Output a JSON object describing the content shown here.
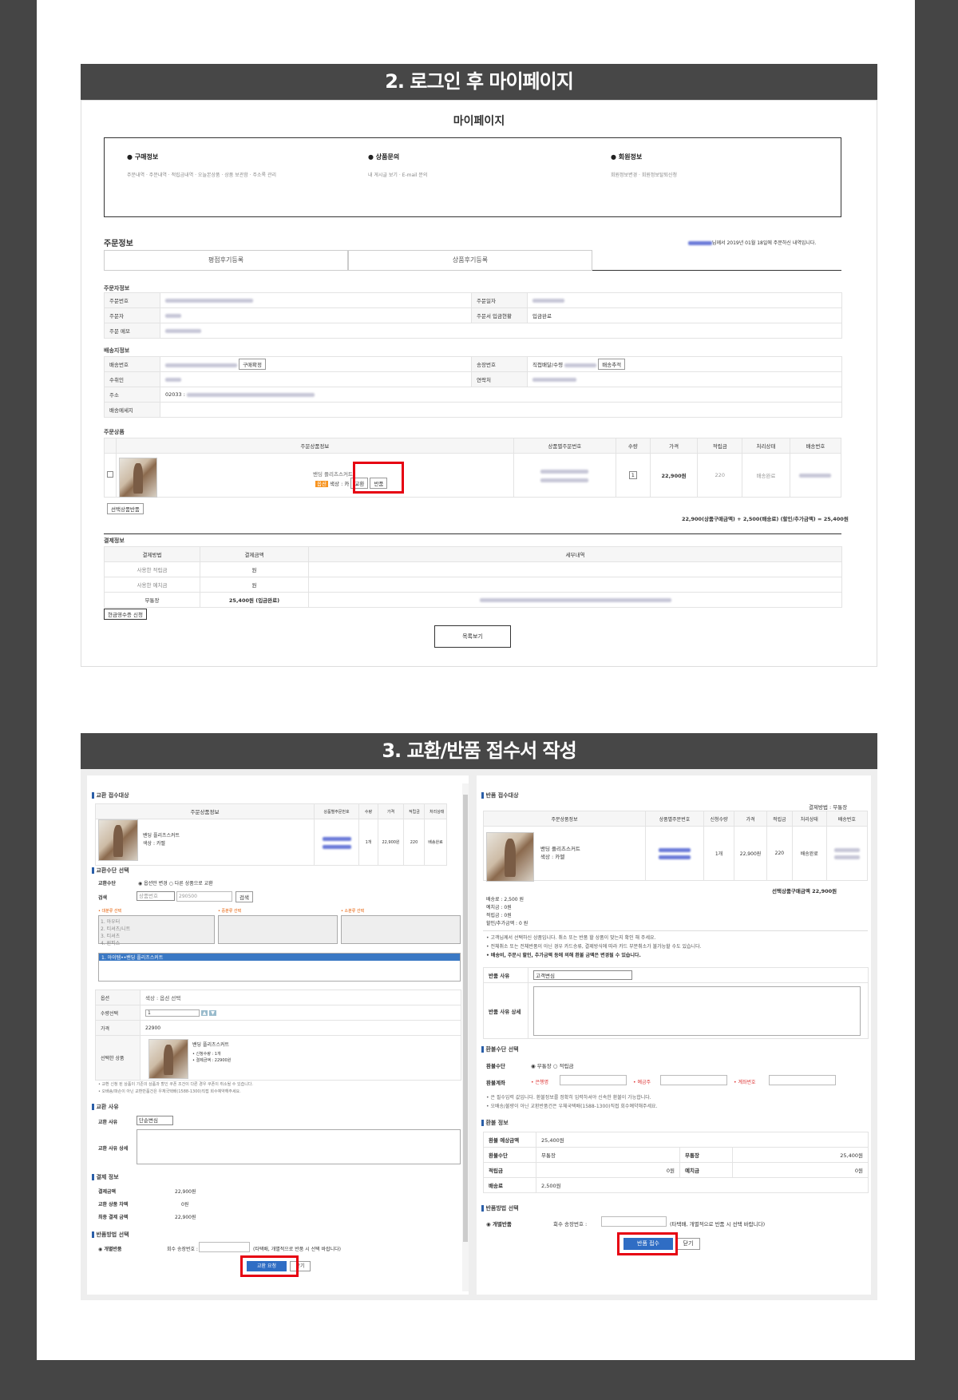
{
  "section2": {
    "title": "2. 로그인 후 마이페이지"
  },
  "mypage": {
    "title": "마이페이지",
    "menu": [
      {
        "heading": "구매정보",
        "links": "주문내역 · 주문내역 · 적립금내역 · 오늘본상품 · 상품 보관함 · 주소록 관리"
      },
      {
        "heading": "상품문의",
        "links": "내 게시글 보기 · E-mail 문의"
      },
      {
        "heading": "회원정보",
        "links": "회원정보변경 · 회원정보탈퇴신청"
      }
    ],
    "order_title": "주문정보",
    "order_note_suffix": "님께서 2019년 01월 18일에 주문하신 내역입니다.",
    "tabs": [
      "평점후기등록",
      "상품후기등록"
    ],
    "orderer_label": "주문자정보",
    "orderer": {
      "order_no": "주문번호",
      "order_date": "주문일자",
      "orderer": "주문자",
      "deposit_status_label": "주문서 입금현황",
      "deposit_status": "입금완료",
      "memo": "주문 메모"
    },
    "delivery_label": "배송지정보",
    "delivery": {
      "ship_no": "배송번호",
      "invoice": "송장번호",
      "invoice_value": "직접배달/수령",
      "receiver": "수취인",
      "contact": "연락처",
      "address": "주소",
      "address_zip": "02033 :",
      "message": "배송메세지",
      "btn_confirm": "구매확정",
      "btn_track": "배송추적"
    },
    "products_label": "주문상품",
    "product_headers": [
      "주문상품정보",
      "상품별주문번호",
      "수량",
      "가격",
      "적립금",
      "처리상태",
      "배송번호"
    ],
    "product": {
      "name": "밴딩 플리츠스커트",
      "option": "색상 : 카",
      "badge": "옵션",
      "btn_exchange": "교환",
      "btn_return": "반품",
      "qty": "1",
      "price": "22,900원",
      "points": "220",
      "status": "배송완료"
    },
    "btn_selected_return": "선택상품반품",
    "total_line": "22,900(상품구매금액) + 2,500(배송료) (할인/추가금액) = 25,400원",
    "payment_label": "결제정보",
    "payment_headers": [
      "결제방법",
      "결제금액",
      "세부내역"
    ],
    "payment_rows": [
      [
        "사용한 적립금",
        "원"
      ],
      [
        "사용한 예치금",
        "원"
      ],
      [
        "무통장",
        "25,400원 (입금완료)"
      ]
    ],
    "btn_receipt": "현금영수증 신청",
    "btn_list": "목록보기"
  },
  "section3": {
    "title": "3. 교환/반품 접수서 작성"
  },
  "exchange": {
    "target_title": "교환 접수대상",
    "headers": [
      "주문상품정보",
      "상품별주문번호",
      "수량",
      "가격",
      "적립금",
      "처리상태"
    ],
    "item": {
      "name": "밴딩 플리츠스커트",
      "option": "색상 : 카멜",
      "qty": "1개",
      "price": "22,900원",
      "points": "220",
      "status": "배송완료"
    },
    "method_title": "교환수단 선택",
    "method_label": "교환수단",
    "method_opt1": "옵션만 변경",
    "method_opt2": "다른 상품으로 교환",
    "search_label": "검색",
    "search_select": "상품번호",
    "search_value": "290500",
    "search_btn": "검색",
    "col1": "• 대분류 선택",
    "col2": "• 중분류 선택",
    "col3": "• 소분류 선택",
    "categories": [
      "1. 아우터",
      "2. 티셔츠/니트",
      "3. 티셔츠",
      "4. 원피스"
    ],
    "selected_product": "1. 아이템••밴딩 플리츠스커트",
    "option_label": "옵션",
    "option_value": "색상 : 옵션 선택",
    "qty_label": "수량선택",
    "qty_value": "1",
    "price_label": "가격",
    "price_value": "22900",
    "chosen_label": "선택한 상품",
    "chosen_name": "밴딩 플리츠스커트",
    "chosen_qty": "• 신청수량 : 1개",
    "chosen_price": "• 결제금액 : 22900원",
    "notes": [
      "• 교환 신청 된 상품이 기존의 상품과 할인 쿠폰 조건이 다른 경우 쿠폰이 취소될 수 있습니다.",
      "• 오배송/파손이 아닌 교환반품건은 우체국택배(1588-1300)직접 회수예약해주세요."
    ],
    "reason_title": "교환 사유",
    "reason_label": "교환 사유",
    "reason_value": "단순변심",
    "reason_detail_label": "교환 사유 상세",
    "pay_title": "결제 정보",
    "pay_rows": [
      [
        "결제금액",
        "22,900원"
      ],
      [
        "교환 상품 차액",
        "0원"
      ],
      [
        "최종 결제 금액",
        "22,900원"
      ]
    ],
    "ship_title": "반품방법 선택",
    "ship_label": "개별반품",
    "ship_input_label": "회수 송장번호 :",
    "ship_note": "(타택배, 개별적으로 반품 시 선택 바랍니다)",
    "btn_submit": "교환 요청",
    "btn_close": "닫기"
  },
  "returns": {
    "target_title": "반품 접수대상",
    "paymethod": "결제방법 : 무통장",
    "headers": [
      "주문상품정보",
      "상품별주문번호",
      "신청수량",
      "가격",
      "적립금",
      "처리상태",
      "배송번호"
    ],
    "item": {
      "name": "밴딩 플리츠스커트",
      "option": "색상 : 카멜",
      "qty": "1개",
      "price": "22,900원",
      "points": "220",
      "status": "배송완료"
    },
    "subtotal": "선택상품구매금액 22,900원",
    "fees": [
      "배송료 : 2,500 원",
      "예치금 : 0원",
      "적립금 : 0원",
      "할인/추가금액 : 0 원"
    ],
    "notes": [
      "• 고객님께서 선택하신 상품입니다. 취소 또는 반품 할 상품이 맞는지 확인 해 주세요.",
      "• 전체취소 또는 전체반품이 아닌 경우 카드승류, 결제방식에 따라 카드 부분취소가 불가능할 수도 있습니다.",
      "• 배송비, 주문시 할인, 추가금액 등에 의해 환불 금액은 변경될 수 있습니다."
    ],
    "reason_label": "반품 사유",
    "reason_value": "고객변심",
    "reason_detail_label": "반품 사유 상세",
    "refund_title": "환불수단 선택",
    "refund_label": "환불수단",
    "refund_opt1": "무통장",
    "refund_opt2": "적립금",
    "account_label": "환불계좌",
    "bank_label": "• 은행명",
    "holder_label": "• 예금주",
    "account_no_label": "• 계좌번호",
    "refund_notes": [
      "• 은 필수입력 값입니다. 환불정보를 정확히 입력하셔야 신속한 환불이 가능합니다.",
      "• 오배송/불량이 아닌 교환반품건은 우체국택배(1588-1300)직접 회수예약해주세요."
    ],
    "info_title": "환불 정보",
    "info": {
      "expected_label": "환불 예상금액",
      "expected": "25,400원",
      "method_label": "환불수단",
      "method": "무통장",
      "bank_label": "무통장",
      "bank": "25,400원",
      "points_label": "적립금",
      "points": "0원",
      "deposit_label": "예치금",
      "deposit": "0원",
      "fee_label": "배송료",
      "fee": "2,500원"
    },
    "ship_title": "반품방법 선택",
    "ship_label": "개별반품",
    "ship_input_label": "회수 송장번호 :",
    "ship_note": "(타택배, 개별적으로 반품 시 선택 바랍니다)",
    "btn_submit": "반품 접수",
    "btn_close": "닫기"
  }
}
